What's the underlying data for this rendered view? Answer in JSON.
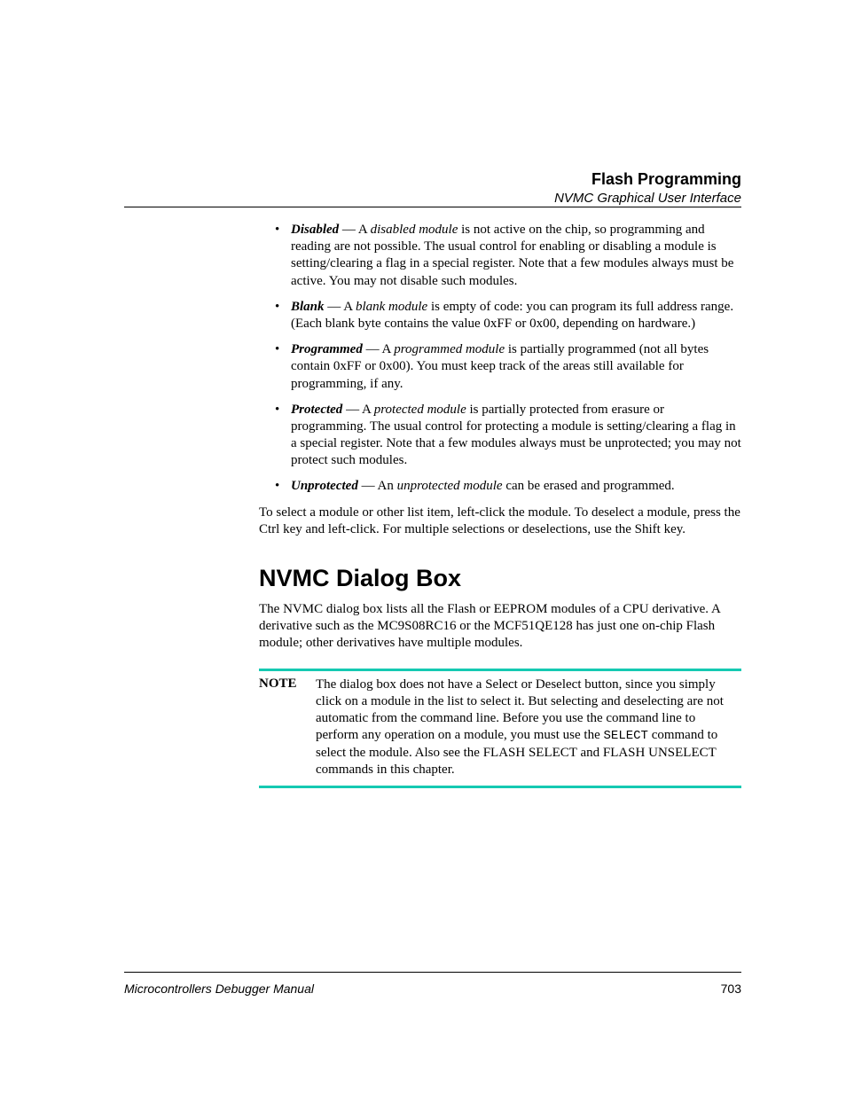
{
  "header": {
    "title": "Flash Programming",
    "subtitle": "NVMC Graphical User Interface"
  },
  "bullets": {
    "disabled": {
      "term": "Disabled",
      "sep": " — A ",
      "italic": "disabled module",
      "rest": " is not active on the chip, so programming and reading are not possible. The usual control for enabling or disabling a module is setting/clearing a flag in a special register. Note that a few modules always must be active. You may not disable such modules."
    },
    "blank": {
      "term": "Blank",
      "sep": " — A ",
      "italic": "blank module",
      "rest": " is empty of code: you can program its full address range. (Each blank byte contains the value 0xFF or 0x00, depending on hardware.)"
    },
    "programmed": {
      "term": "Programmed",
      "sep": " — A ",
      "italic": "programmed module",
      "rest": " is partially programmed (not all bytes contain 0xFF or 0x00). You must keep track of the areas still available for programming, if any."
    },
    "protected": {
      "term": "Protected",
      "sep": " — A ",
      "italic": "protected module",
      "rest": " is partially protected from erasure or programming. The usual control for protecting a module is setting/clearing a flag in a special register. Note that a few modules always must be unprotected; you may not protect such modules."
    },
    "unprotected": {
      "term": "Unprotected",
      "sep": " — An ",
      "italic": "unprotected module",
      "rest": " can be erased and programmed."
    }
  },
  "selection_para": "To select a module or other list item, left-click the module. To deselect a module, press the Ctrl key and left-click. For multiple selections or deselections, use the Shift key.",
  "section": {
    "heading": "NVMC Dialog Box",
    "intro": "The NVMC dialog box lists all the Flash or EEPROM modules of a CPU derivative. A derivative such as the MC9S08RC16 or the MCF51QE128 has just one on-chip Flash module; other derivatives have multiple modules."
  },
  "note": {
    "label": "NOTE",
    "text_pre": "The dialog box does not have a Select or Deselect button, since you simply click on a module in the list to select it. But selecting and deselecting are not automatic from the command line. Before you use the command line to perform any operation on a module, you must use the ",
    "cmd": "SELECT",
    "text_post": " command to select the module. Also see the FLASH SELECT and FLASH UNSELECT commands in this chapter."
  },
  "footer": {
    "left": "Microcontrollers Debugger Manual",
    "right": "703"
  }
}
